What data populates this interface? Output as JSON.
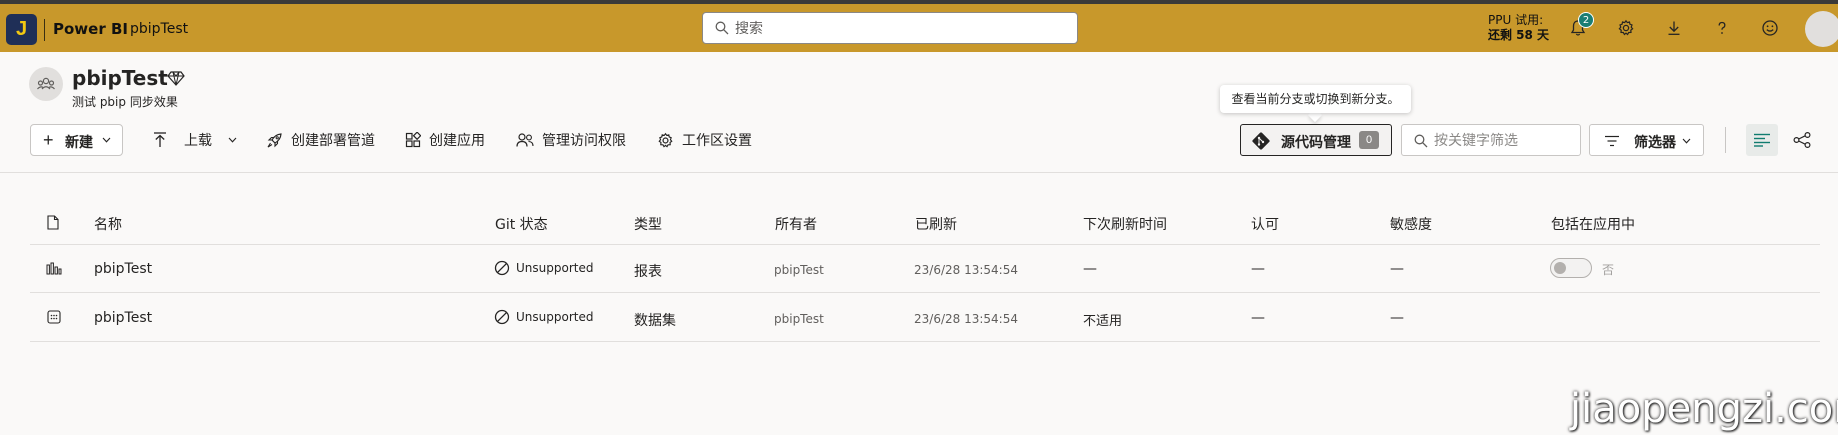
{
  "topbar": {
    "logo_letter": "J",
    "app_name": "Power BI",
    "breadcrumb": "pbipTest",
    "search_placeholder": "搜索",
    "trial_line1": "PPU 试用:",
    "trial_line2": "还剩 58 天",
    "notification_count": "2",
    "icons": [
      "bell-icon",
      "gear-icon",
      "download-icon",
      "help-icon",
      "feedback-smiley-icon"
    ],
    "color": "#c8982b"
  },
  "workspace": {
    "title": "pbipTest",
    "description": "测试 pbip 同步效果"
  },
  "toolbar": {
    "new_label": "新建",
    "upload_label": "上载",
    "pipeline_label": "创建部署管道",
    "create_app_label": "创建应用",
    "manage_access_label": "管理访问权限",
    "workspace_settings_label": "工作区设置",
    "tooltip": "查看当前分支或切换到新分支。",
    "source_control_label": "源代码管理",
    "source_control_count": "0",
    "filter_placeholder": "按关键字筛选",
    "filters_label": "筛选器"
  },
  "table": {
    "columns": {
      "name": "名称",
      "git_status": "Git 状态",
      "type": "类型",
      "owner": "所有者",
      "refreshed": "已刷新",
      "next_refresh": "下次刷新时间",
      "endorsement": "认可",
      "sensitivity": "敏感度",
      "included_in_app": "包括在应用中"
    },
    "rows": [
      {
        "icon": "report-icon",
        "name": "pbipTest",
        "git_status": "Unsupported",
        "type": "报表",
        "owner": "pbipTest",
        "refreshed": "23/6/28 13:54:54",
        "next_refresh": "—",
        "endorsement": "—",
        "sensitivity": "—",
        "included_in_app": "否"
      },
      {
        "icon": "dataset-icon",
        "name": "pbipTest",
        "git_status": "Unsupported",
        "type": "数据集",
        "owner": "pbipTest",
        "refreshed": "23/6/28 13:54:54",
        "next_refresh": "不适用",
        "endorsement": "—",
        "sensitivity": "—",
        "included_in_app": ""
      }
    ]
  },
  "watermark": "jiaopengzi.com"
}
